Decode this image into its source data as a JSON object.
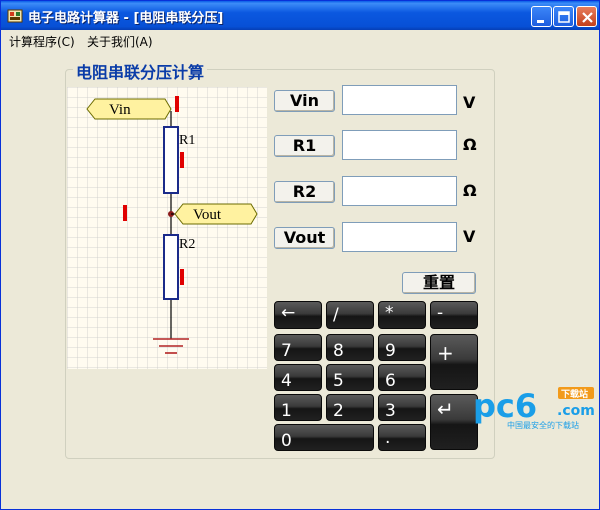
{
  "window": {
    "title": "电子电路计算器 - [电阻串联分压]"
  },
  "menu": {
    "items": [
      "计算程序(C)",
      "关于我们(A)"
    ]
  },
  "panel": {
    "title": "电阻串联分压计算"
  },
  "circuit": {
    "vin_label": "Vin",
    "vout_label": "Vout",
    "r1_label": "R1",
    "r2_label": "R2"
  },
  "fields": [
    {
      "button": "Vin",
      "value": "",
      "unit": "V"
    },
    {
      "button": "R1",
      "value": "",
      "unit": "Ω"
    },
    {
      "button": "R2",
      "value": "",
      "unit": "Ω"
    },
    {
      "button": "Vout",
      "value": "",
      "unit": "V"
    }
  ],
  "reset_label": "重置",
  "keypad": {
    "backspace": "←",
    "divide": "/",
    "multiply": "*",
    "minus": "-",
    "plus": "+",
    "enter": "↵",
    "dot": ".",
    "zero": "0",
    "digits": [
      "7",
      "8",
      "9",
      "4",
      "5",
      "6",
      "1",
      "2",
      "3"
    ]
  },
  "watermark": {
    "brand": "pc6",
    "domain": ".com",
    "tag": "下载站",
    "slogan": "中国最安全的下载站"
  }
}
